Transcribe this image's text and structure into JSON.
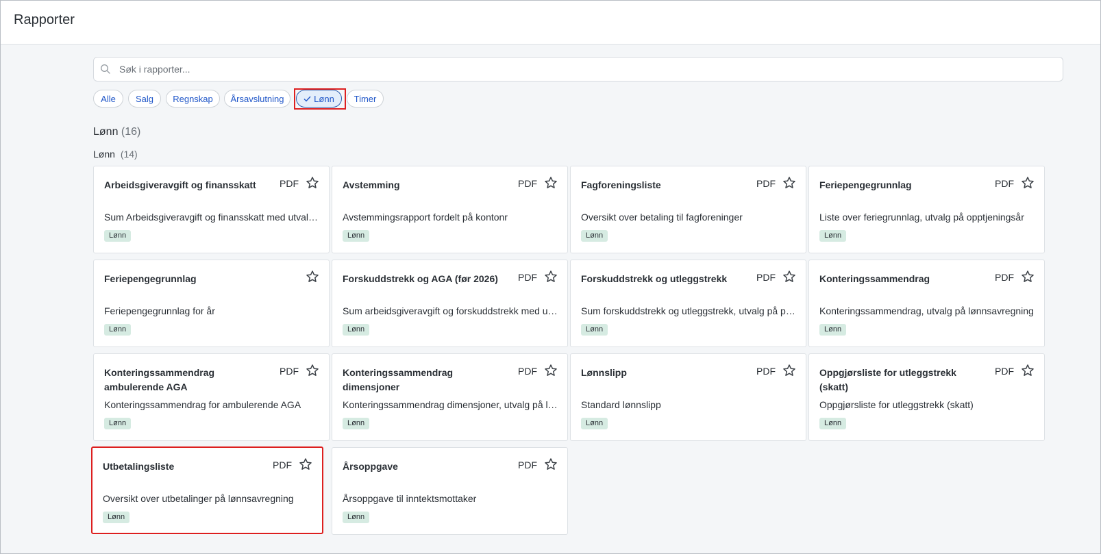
{
  "header": {
    "title": "Rapporter"
  },
  "search": {
    "placeholder": "Søk i rapporter..."
  },
  "filters": [
    {
      "label": "Alle",
      "active": false
    },
    {
      "label": "Salg",
      "active": false
    },
    {
      "label": "Regnskap",
      "active": false
    },
    {
      "label": "Årsavslutning",
      "active": false
    },
    {
      "label": "Lønn",
      "active": true
    },
    {
      "label": "Timer",
      "active": false
    }
  ],
  "group": {
    "title": "Lønn",
    "count": "(16)"
  },
  "subgroup": {
    "title": "Lønn",
    "count": "(14)"
  },
  "reports": [
    {
      "name": "Arbeidsgiveravgift og finansskatt",
      "format": "PDF",
      "description": "Sum Arbeidsgiveravgift og finansskatt med utvalg på periode",
      "tag": "Lønn"
    },
    {
      "name": "Avstemming",
      "format": "PDF",
      "description": "Avstemmingsrapport fordelt på kontonr",
      "tag": "Lønn"
    },
    {
      "name": "Fagforeningsliste",
      "format": "PDF",
      "description": "Oversikt over betaling til fagforeninger",
      "tag": "Lønn"
    },
    {
      "name": "Feriepengegrunnlag",
      "format": "PDF",
      "description": "Liste over feriegrunnlag, utvalg på opptjeningsår",
      "tag": "Lønn"
    },
    {
      "name": "Feriepengegrunnlag",
      "format": "",
      "description": "Feriepengegrunnlag for år",
      "tag": "Lønn"
    },
    {
      "name": "Forskuddstrekk og AGA (før 2026)",
      "format": "PDF",
      "description": "Sum arbeidsgiveravgift og forskuddstrekk med utvalg",
      "tag": "Lønn"
    },
    {
      "name": "Forskuddstrekk og utleggstrekk",
      "format": "PDF",
      "description": "Sum forskuddstrekk og utleggstrekk, utvalg på periode",
      "tag": "Lønn"
    },
    {
      "name": "Konteringssammendrag",
      "format": "PDF",
      "description": "Konteringssammendrag, utvalg på lønnsavregning",
      "tag": "Lønn"
    },
    {
      "name": "Konteringssammendrag ambulerende AGA",
      "format": "PDF",
      "description": "Konteringssammendrag for ambulerende AGA",
      "tag": "Lønn"
    },
    {
      "name": "Konteringssammendrag dimensjoner",
      "format": "PDF",
      "description": "Konteringssammendrag dimensjoner, utvalg på lønnsavregning",
      "tag": "Lønn"
    },
    {
      "name": "Lønnslipp",
      "format": "PDF",
      "description": "Standard lønnslipp",
      "tag": "Lønn"
    },
    {
      "name": "Oppgjørsliste for utleggstrekk (skatt)",
      "format": "PDF",
      "description": "Oppgjørsliste for utleggstrekk (skatt)",
      "tag": "Lønn"
    },
    {
      "name": "Utbetalingsliste",
      "format": "PDF",
      "description": "Oversikt over utbetalinger på lønnsavregning",
      "tag": "Lønn"
    },
    {
      "name": "Årsoppgave",
      "format": "PDF",
      "description": "Årsoppgave til inntektsmottaker",
      "tag": "Lønn"
    }
  ]
}
